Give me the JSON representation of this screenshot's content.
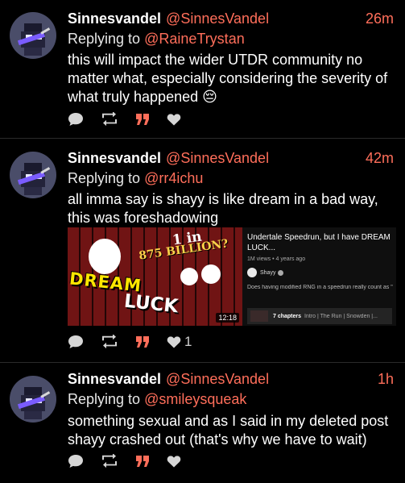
{
  "posts": [
    {
      "author": "Sinnesvandel",
      "handle": "@SinnesVandel",
      "time": "26m",
      "reply_prefix": "Replying to ",
      "reply_to": "@RaineTrystan",
      "text": "this will impact the wider UTDR community no matter what, especially considering the severity of what truly happened 😔",
      "like_count": ""
    },
    {
      "author": "Sinnesvandel",
      "handle": "@SinnesVandel",
      "time": "42m",
      "reply_prefix": "Replying to ",
      "reply_to": "@rr4ichu",
      "text": "all imma say is shayy is like dream in a bad way, this was foreshadowing",
      "like_count": "1",
      "embed": {
        "title": "Undertale Speedrun, but I have DREAM LUCK...",
        "meta": "1M views • 4 years ago",
        "channel": "Shayy",
        "description": "Does having modified RNG in a speedrun really count as \"c",
        "chapters_label": "7 chapters",
        "chapters_desc": "Intro | The Run | Snowden |...",
        "duration": "12:18",
        "thumb_text_dream": "DREAM",
        "thumb_text_luck": "LUCK",
        "thumb_text_1in": "1 in",
        "thumb_text_billion": "875 BILLION?"
      }
    },
    {
      "author": "Sinnesvandel",
      "handle": "@SinnesVandel",
      "time": "1h",
      "reply_prefix": "Replying to ",
      "reply_to": "@smileysqueak",
      "text": "something sexual and as I said in my deleted post shayy crashed out (that's why we have to wait)",
      "like_count": ""
    }
  ],
  "colors": {
    "background": "#000000",
    "accent": "#ff6e5a",
    "text": "#ffffff",
    "avatar_bg": "#4a4d69"
  },
  "icons": [
    "reply-icon",
    "repost-icon",
    "quote-icon",
    "like-icon"
  ]
}
